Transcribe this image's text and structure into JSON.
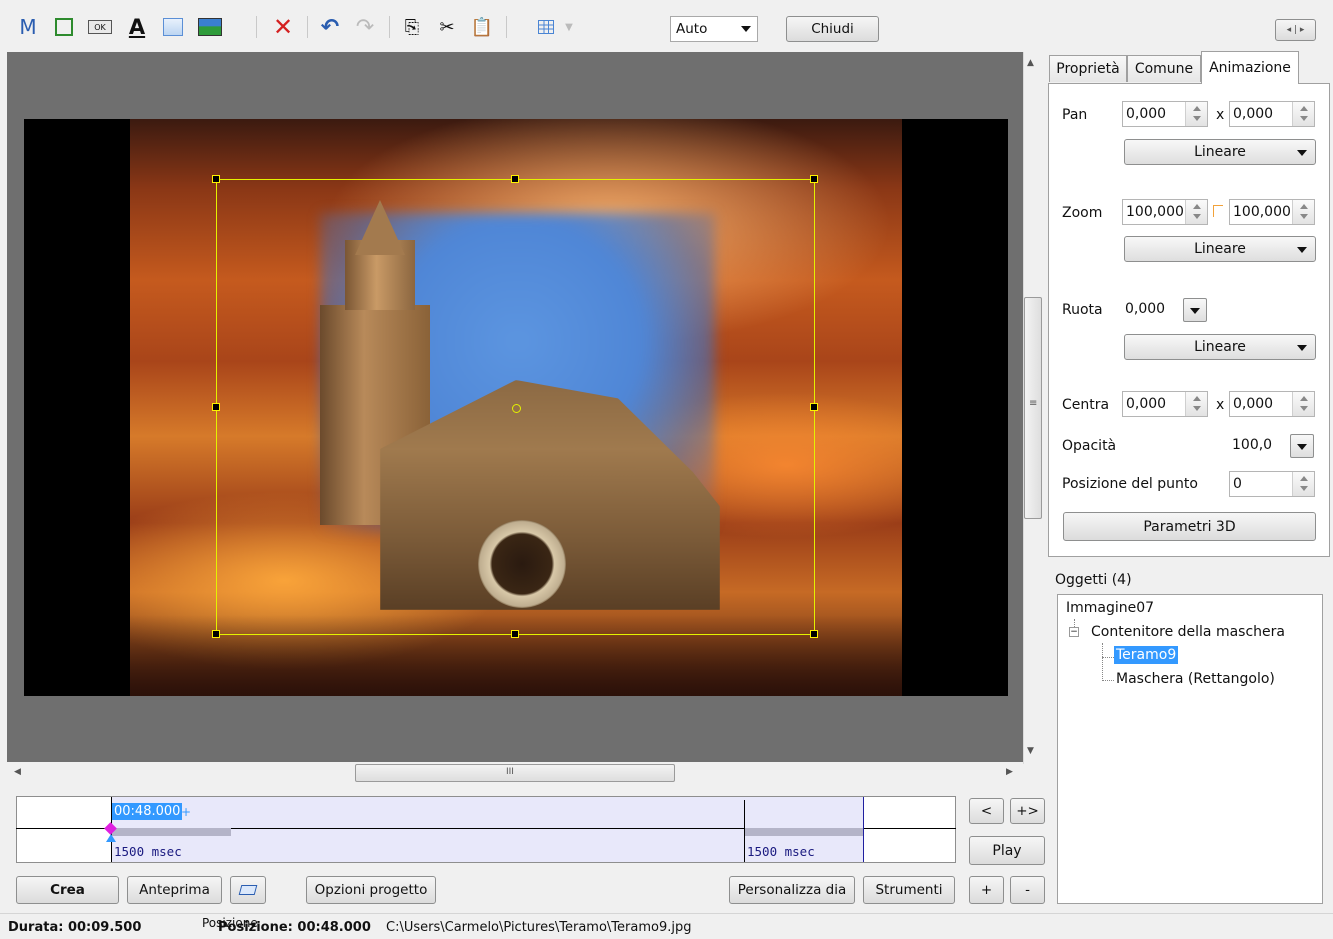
{
  "toolbar": {
    "mask_letter": "M",
    "ok_icon_text": "OK",
    "text_icon": "A",
    "aspect_label": "Auto",
    "close_label": "Chiudi",
    "icons": [
      "mask-letter-icon",
      "frame-icon",
      "button-ok-icon",
      "text-icon",
      "rectangle-icon",
      "image-icon",
      "delete-icon",
      "undo-icon",
      "redo-icon",
      "copy-icon",
      "cut-icon",
      "paste-icon",
      "grid-icon"
    ],
    "colors": {
      "delete": "#d42020",
      "accent": "#2a5db0"
    }
  },
  "tabs": [
    {
      "label": "Proprietà"
    },
    {
      "label": "Comune"
    },
    {
      "label": "Animazione"
    }
  ],
  "animation": {
    "pan_label": "Pan",
    "pan_x": "0,000",
    "pan_y": "0,000",
    "x_sep": "x",
    "pan_mode": "Lineare",
    "zoom_label": "Zoom",
    "zoom_x": "100,000",
    "zoom_y": "100,000",
    "zoom_mode": "Lineare",
    "rotate_label": "Ruota",
    "rotate_value": "0,000",
    "rotate_mode": "Lineare",
    "center_label": "Centra",
    "center_x": "0,000",
    "center_y": "0,000",
    "opacity_label": "Opacità",
    "opacity_value": "100,0",
    "point_label": "Posizione del punto",
    "point_value": "0",
    "params3d_label": "Parametri 3D"
  },
  "objects": {
    "title": "Oggetti (4)",
    "items": [
      {
        "label": "Immagine07"
      },
      {
        "label": "Contenitore della maschera"
      },
      {
        "label": "Teramo9"
      },
      {
        "label": "Maschera (Rettangolo)"
      }
    ],
    "selected_color": "#3399ff"
  },
  "timeline": {
    "time": "00:48.000",
    "left_duration": "1500 msec",
    "right_duration": "1500 msec",
    "prev_label": "<",
    "next_label": "+>",
    "play_label": "Play",
    "plus_label": "+",
    "minus_label": "-"
  },
  "scroll": {
    "h_thumb_glyph": "III",
    "v_thumb_glyph": "≡"
  },
  "bottom_buttons": {
    "create": "Crea",
    "preview": "Anteprima",
    "project_options": "Opzioni progetto",
    "customize_slide": "Personalizza dia",
    "tools": "Strumenti"
  },
  "status": {
    "duration": "Durata: 00:09.500",
    "position_label": "Posizione",
    "position": "Posizione: 00:48.000",
    "path": "C:\\Users\\Carmelo\\Pictures\\Teramo\\Teramo9.jpg"
  }
}
